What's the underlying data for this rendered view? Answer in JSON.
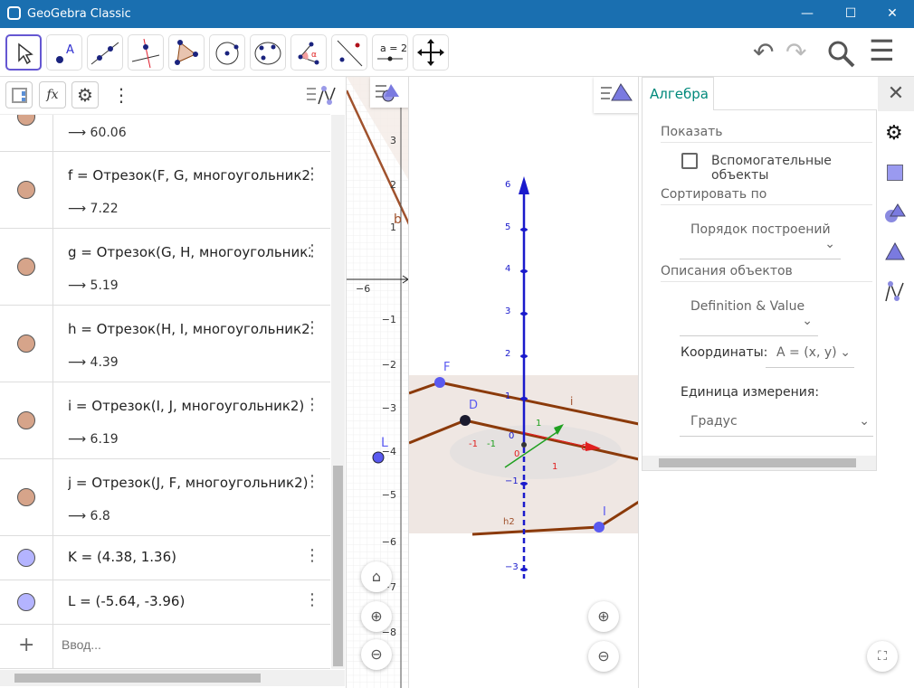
{
  "window": {
    "title": "GeoGebra Classic",
    "minimize": "—",
    "maximize": "☐",
    "close": "✕"
  },
  "toolbar": {
    "tools": [
      "move-tool",
      "point-tool",
      "line-tool",
      "perpendicular-line-tool",
      "polygon-tool",
      "circle-center-tool",
      "conic-five-points-tool",
      "angle-tool",
      "reflect-tool",
      "slider-tool",
      "move-graphics-view-tool"
    ],
    "point_label": "A",
    "slider_label": "a = 2",
    "undo": "↶",
    "redo": "↷",
    "search": "search-icon",
    "menu": "☰"
  },
  "algebra": {
    "header_icons": [
      "algebra-tree-icon",
      "fx-icon",
      "gear-icon",
      "more-icon",
      "graphing-style-icon"
    ],
    "fx": "fx",
    "partial_value": "60.06",
    "rows": [
      {
        "def": "f = Отрезок(F, G, многоугольник2)",
        "val": "7.22",
        "color": "#d6a48a"
      },
      {
        "def": "g = Отрезок(G, H, многоугольник2)",
        "val": "5.19",
        "color": "#d6a48a"
      },
      {
        "def": "h = Отрезок(H, I, многоугольник2)",
        "val": "4.39",
        "color": "#d6a48a"
      },
      {
        "def": "i = Отрезок(I, J, многоугольник2)",
        "val": "6.19",
        "color": "#d6a48a"
      },
      {
        "def": "j = Отрезок(J, F, многоугольник2)",
        "val": "6.8",
        "color": "#d6a48a"
      }
    ],
    "points": [
      {
        "def": "K = (4.38, 1.36)",
        "color": "#b4b4ff"
      },
      {
        "def": "L = (-5.64, -3.96)",
        "color": "#b4b4ff"
      }
    ],
    "input_placeholder": "Ввод...",
    "arrow": "⟶"
  },
  "graphics2d": {
    "y_ticks": [
      "3",
      "2",
      "1",
      "−1",
      "−2",
      "−3",
      "−4",
      "−5",
      "−6",
      "−7",
      "−8"
    ],
    "x_tick": "−6",
    "labels": {
      "b": "b",
      "L": "L"
    }
  },
  "graphics3d": {
    "z_ticks": [
      "6",
      "5",
      "4",
      "3",
      "2",
      "1",
      "−1",
      "−3"
    ],
    "labels": {
      "F": "F",
      "D": "D",
      "I": "I",
      "i": "i",
      "d": "d",
      "h2": "h2"
    },
    "axis_small": [
      "-1",
      "-1",
      "0",
      "1",
      "1",
      "0"
    ],
    "colors": {
      "z": "#1a1acc",
      "x": "#e02020",
      "y": "#20a020",
      "segment": "#8b3a0a",
      "point": "#5a5af0"
    }
  },
  "properties": {
    "tab": "Алгебра",
    "show_label": "Показать",
    "aux_checkbox": "Вспомогательные объекты",
    "aux_checked": false,
    "sort_label": "Сортировать по",
    "sort_value": "Порядок построений",
    "desc_label": "Описания объектов",
    "desc_value": "Definition & Value",
    "coords_label": "Координаты:",
    "coords_value": "A = (x, y)",
    "angle_label": "Единица измерения:",
    "angle_value": "Градус",
    "side_icons": [
      "gear-icon",
      "basic-object-icon",
      "graphics-icon",
      "graphics3d-icon",
      "algebra-icon"
    ],
    "accent": "#00897b"
  }
}
